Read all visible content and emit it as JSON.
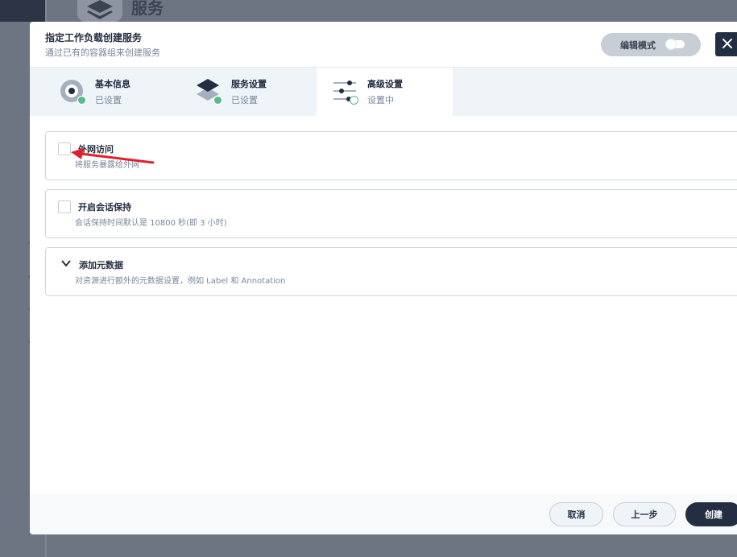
{
  "background": {
    "page_title": "服务"
  },
  "modal": {
    "title": "指定工作负载创建服务",
    "subtitle": "通过已有的容器组来创建服务",
    "edit_mode_label": "编辑模式",
    "close_label": "×"
  },
  "steps": [
    {
      "label": "基本信息",
      "status": "已设置",
      "icon": "basic-info-icon"
    },
    {
      "label": "服务设置",
      "status": "已设置",
      "icon": "service-settings-icon"
    },
    {
      "label": "高级设置",
      "status": "设置中",
      "icon": "advanced-settings-icon"
    }
  ],
  "options": {
    "external_access": {
      "title": "外网访问",
      "desc": "将服务暴露给外网",
      "checked": false
    },
    "session_affinity": {
      "title": "开启会话保持",
      "desc": "会话保持时间默认是 10800 秒(即 3 小时)",
      "checked": false
    },
    "metadata": {
      "title": "添加元数据",
      "desc": "对资源进行额外的元数据设置，例如 Label 和 Annotation"
    }
  },
  "footer": {
    "cancel_label": "取消",
    "prev_label": "上一步",
    "create_label": "创建"
  },
  "colors": {
    "primary": "#242e42",
    "success": "#55bc8a",
    "annotation_arrow": "#e0202b"
  }
}
